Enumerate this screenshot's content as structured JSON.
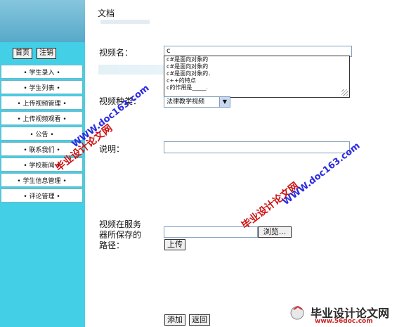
{
  "sidebar": {
    "buttons": {
      "home": "首页",
      "logout": "注销"
    },
    "items": [
      "• 学生录入 •",
      "• 学生列表 •",
      "• 上传视频管理 •",
      "• 上传视频观看 •",
      "• 公告 •",
      "• 联系我们 •",
      "• 学校新闻 •",
      "• 学生信息管理 •",
      "• 评论管理 •"
    ]
  },
  "main": {
    "title": "文档",
    "video_name": {
      "label": "视频名：",
      "value": "c"
    },
    "autocomplete": [
      "c#是面向对象的",
      "c#是面向对象的",
      "c#是面向对象的．",
      "c++的特点",
      "c的作用是_____."
    ],
    "video_type": {
      "label": "视频种类：",
      "value": "法律教学视频"
    },
    "description": {
      "label": "说明："
    },
    "path": {
      "label_line1": "视频在服务",
      "label_line2": "器所保存的",
      "label_line3": "路径：",
      "browse": "浏览...",
      "upload": "上传"
    },
    "actions": {
      "add": "添加",
      "back": "返回"
    }
  },
  "watermarks": {
    "site": "毕业设计论文网",
    "url": "WWW.doc163.com",
    "logo": "毕业设计论文网",
    "logo_url": "www.56doc.com"
  }
}
